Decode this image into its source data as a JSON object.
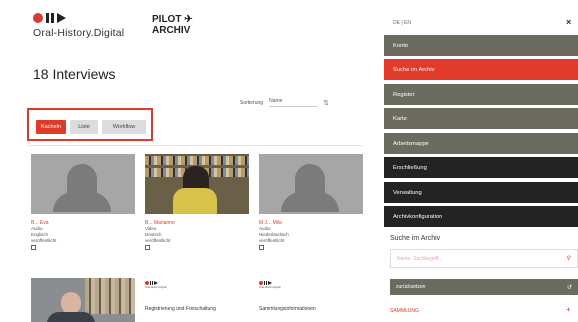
{
  "header": {
    "logo_text": "Oral-History.Digital",
    "pilot_line1": "PILOT",
    "pilot_line2": "ARCHIV"
  },
  "main": {
    "title": "18 Interviews",
    "sort_label": "Sortierung",
    "sort_value": "Name",
    "view_buttons": [
      "Kacheln",
      "Liste",
      "Workflow"
    ],
    "cards": [
      {
        "name": "B... Eva",
        "type": "Audio",
        "language": "Englisch",
        "status": "veröffentlicht"
      },
      {
        "name": "B... Marianne",
        "type": "Video",
        "language": "Deutsch",
        "status": "veröffentlicht"
      },
      {
        "name": "M J... Mila",
        "type": "Audio",
        "language": "Niederländisch",
        "status": "veröffentlicht"
      }
    ],
    "news": [
      {
        "mini_logo": "Oral-History.Digital",
        "title": "Registrierung und Freischaltung"
      },
      {
        "mini_logo": "Oral-History.Digital",
        "title": "Sammlungsinformationen"
      }
    ]
  },
  "sidebar": {
    "lang": "DE | EN",
    "close": "×",
    "menu": [
      {
        "label": "Konto",
        "style": "olive"
      },
      {
        "label": "Suche im Archiv",
        "style": "red"
      },
      {
        "label": "Register",
        "style": "olive"
      },
      {
        "label": "Karte",
        "style": "olive"
      },
      {
        "label": "Arbeitsmappe",
        "style": "olive"
      },
      {
        "label": "Erschließung",
        "style": "dark"
      },
      {
        "label": "Verwaltung",
        "style": "dark"
      },
      {
        "label": "Archivkonfiguration",
        "style": "dark"
      }
    ],
    "search_heading": "Suche im Archiv",
    "search_placeholder": "Name, Suchbegriff...",
    "reset_label": "zurücksetzen",
    "sammlung_label": "SAMMLUNG"
  }
}
